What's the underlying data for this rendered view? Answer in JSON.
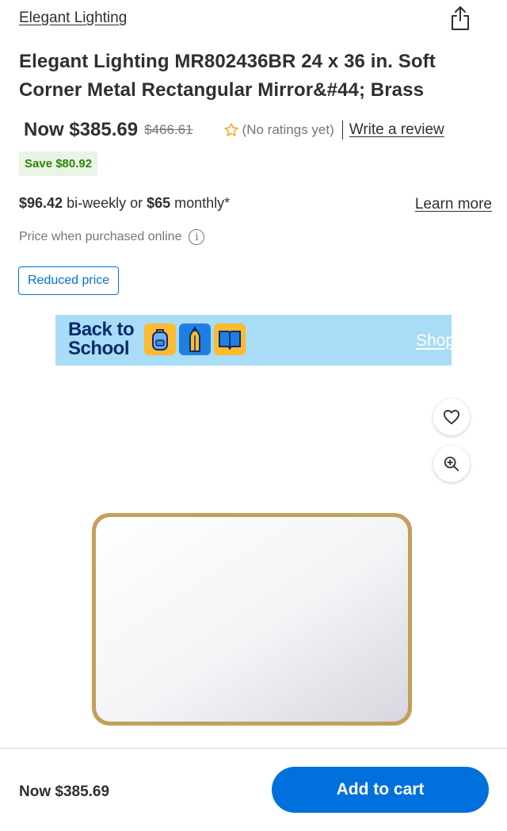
{
  "header": {
    "brand_link": "Elegant Lighting",
    "share_icon": "share-icon"
  },
  "product": {
    "title": "Elegant Lighting MR802436BR 24 x 36 in. Soft Corner Metal Rectangular Mirror&#44; Brass",
    "now_price": "Now $385.69",
    "was_price": "$466.61",
    "ratings_text": "(No ratings yet)",
    "review_link": "Write a review",
    "save_badge": "Save $80.92",
    "installment": {
      "biweekly_amount": "$96.42",
      "biweekly_text": " bi-weekly or ",
      "monthly_amount": "$65",
      "monthly_text": " monthly*"
    },
    "learn_more": "Learn more",
    "price_note": "Price when purchased online",
    "reduced_badge": "Reduced price"
  },
  "promo": {
    "title_line1": "Back to",
    "title_line2": "School",
    "icons": [
      "backpack-icon",
      "pencil-icon",
      "book-icon"
    ],
    "shop_link": "Shop"
  },
  "image_actions": {
    "favorite_icon": "heart-icon",
    "zoom_icon": "zoom-in-icon"
  },
  "bottom_bar": {
    "price": "Now $385.69",
    "add_to_cart": "Add to cart"
  },
  "colors": {
    "accent": "#0071dc",
    "save_green": "#2a8703",
    "save_bg": "#eaf3e6",
    "promo_bg": "#a8dcf7",
    "mirror_frame": "#c2a05a",
    "text": "#2e2f32",
    "muted": "#74767c"
  }
}
